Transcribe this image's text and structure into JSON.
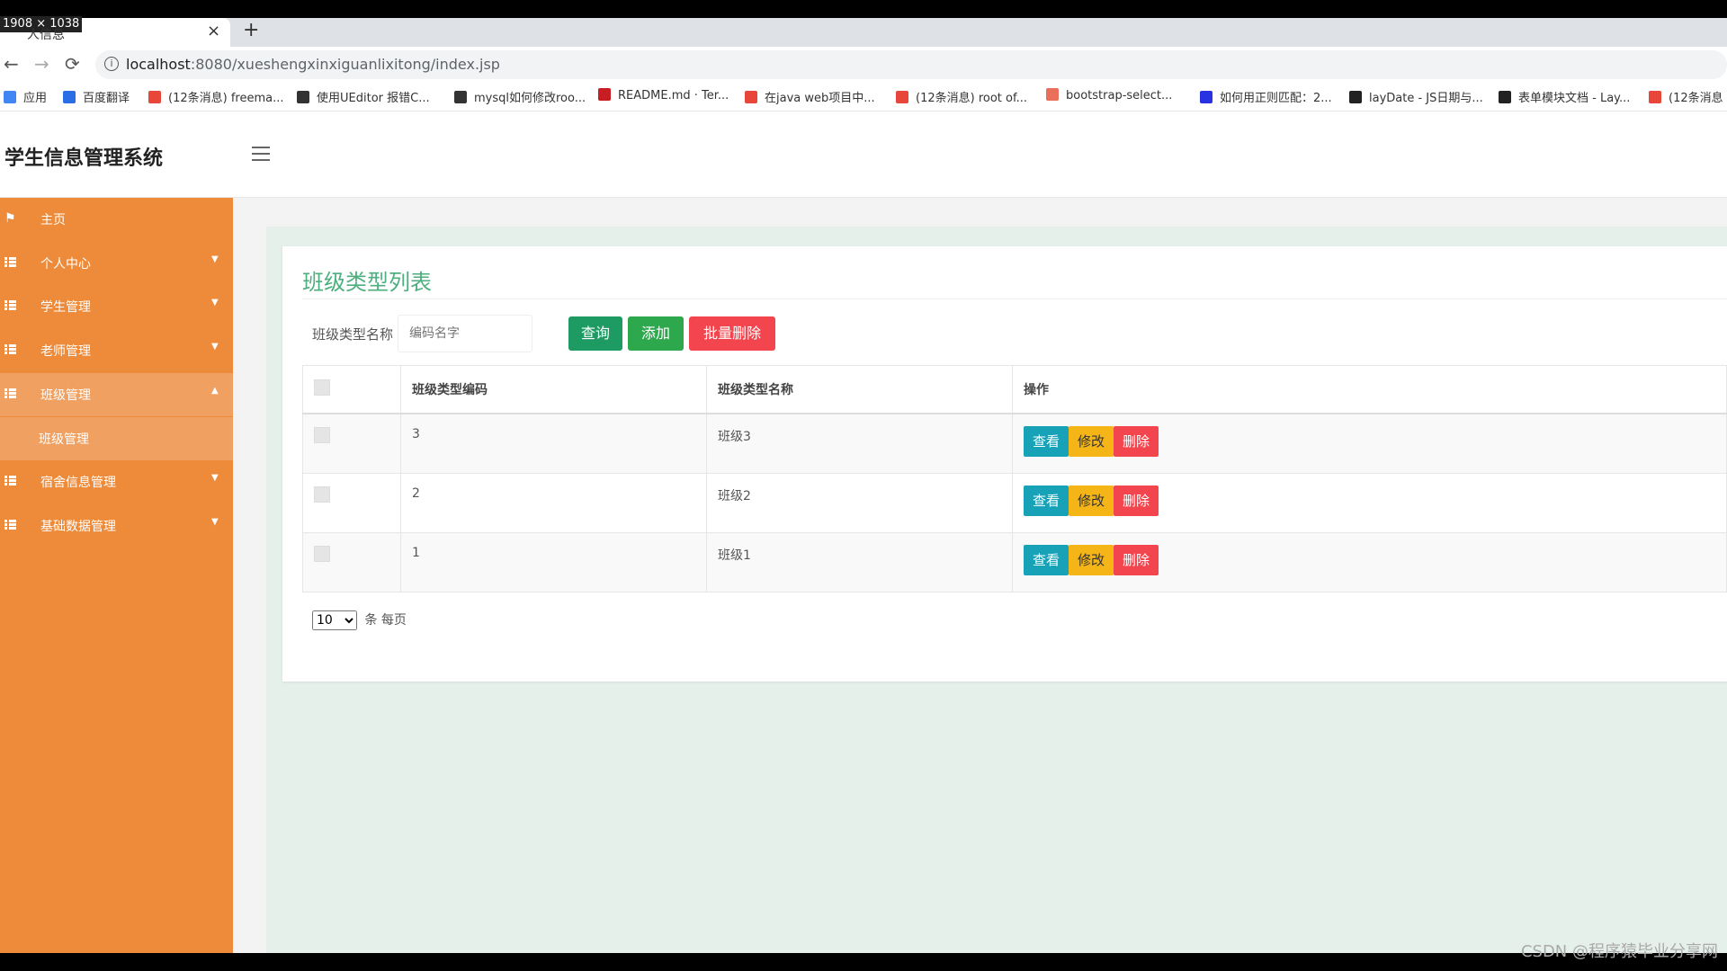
{
  "browser": {
    "size_badge": "1908 × 1038",
    "tab_title": "人信息",
    "tab_close": "×",
    "new_tab": "+",
    "url_host": "localhost",
    "url_rest": ":8080/xueshengxinxiguanlixitong/index.jsp",
    "bookmarks": [
      {
        "label": "应用",
        "icon": "apps-grid-icon",
        "color": "#4285f4"
      },
      {
        "label": "百度翻译",
        "icon": "baidu-translate-icon",
        "color": "#2b6de5"
      },
      {
        "label": "(12条消息) freema...",
        "icon": "csdn-icon",
        "color": "#e8463a"
      },
      {
        "label": "使用UEditor 报错C...",
        "icon": "wolf-icon",
        "color": "#333333"
      },
      {
        "label": "mysql如何修改roo...",
        "icon": "wolf-icon",
        "color": "#333333"
      },
      {
        "label": "README.md · Ter...",
        "icon": "gitee-icon",
        "color": "#c71d23"
      },
      {
        "label": "在java web项目中...",
        "icon": "csdn-icon",
        "color": "#e8463a"
      },
      {
        "label": "(12条消息) root of...",
        "icon": "csdn-icon",
        "color": "#e8463a"
      },
      {
        "label": "bootstrap-select...",
        "icon": "jianshu-icon",
        "color": "#ea6f5a"
      },
      {
        "label": "如何用正则匹配：2...",
        "icon": "baidu-paw-icon",
        "color": "#2932e1"
      },
      {
        "label": "layDate - JS日期与...",
        "icon": "layui-icon",
        "color": "#222222"
      },
      {
        "label": "表单模块文档 - Lay...",
        "icon": "layui-icon",
        "color": "#222222"
      },
      {
        "label": "(12条消息",
        "icon": "csdn-icon",
        "color": "#e8463a"
      }
    ]
  },
  "app": {
    "title": "学生信息管理系统",
    "accent": "#ee8b3a",
    "sidebar": [
      {
        "label": "主页",
        "icon": "flag-icon",
        "caret": ""
      },
      {
        "label": "个人中心",
        "icon": "grid-list-icon",
        "caret": "▼"
      },
      {
        "label": "学生管理",
        "icon": "grid-list-icon",
        "caret": "▼"
      },
      {
        "label": "老师管理",
        "icon": "grid-list-icon",
        "caret": "▼"
      },
      {
        "label": "班级管理",
        "icon": "grid-list-icon",
        "caret": "▲"
      },
      {
        "label": "班级管理",
        "icon": "",
        "caret": ""
      },
      {
        "label": "宿舍信息管理",
        "icon": "grid-list-icon",
        "caret": "▼"
      },
      {
        "label": "基础数据管理",
        "icon": "grid-list-icon",
        "caret": "▼"
      }
    ],
    "panel": {
      "title": "班级类型列表",
      "search_label": "班级类型名称",
      "search_placeholder": "编码名字",
      "btn_query": "查询",
      "btn_add": "添加",
      "btn_batch_delete": "批量删除",
      "columns": [
        "",
        "班级类型编码",
        "班级类型名称",
        "操作"
      ],
      "rows": [
        {
          "code": "3",
          "name": "班级3"
        },
        {
          "code": "2",
          "name": "班级2"
        },
        {
          "code": "1",
          "name": "班级1"
        }
      ],
      "row_actions": {
        "view": "查看",
        "edit": "修改",
        "delete": "删除"
      },
      "page_size": "10",
      "page_size_suffix": "条 每页"
    }
  },
  "watermark": "CSDN @程序猿毕业分享网"
}
